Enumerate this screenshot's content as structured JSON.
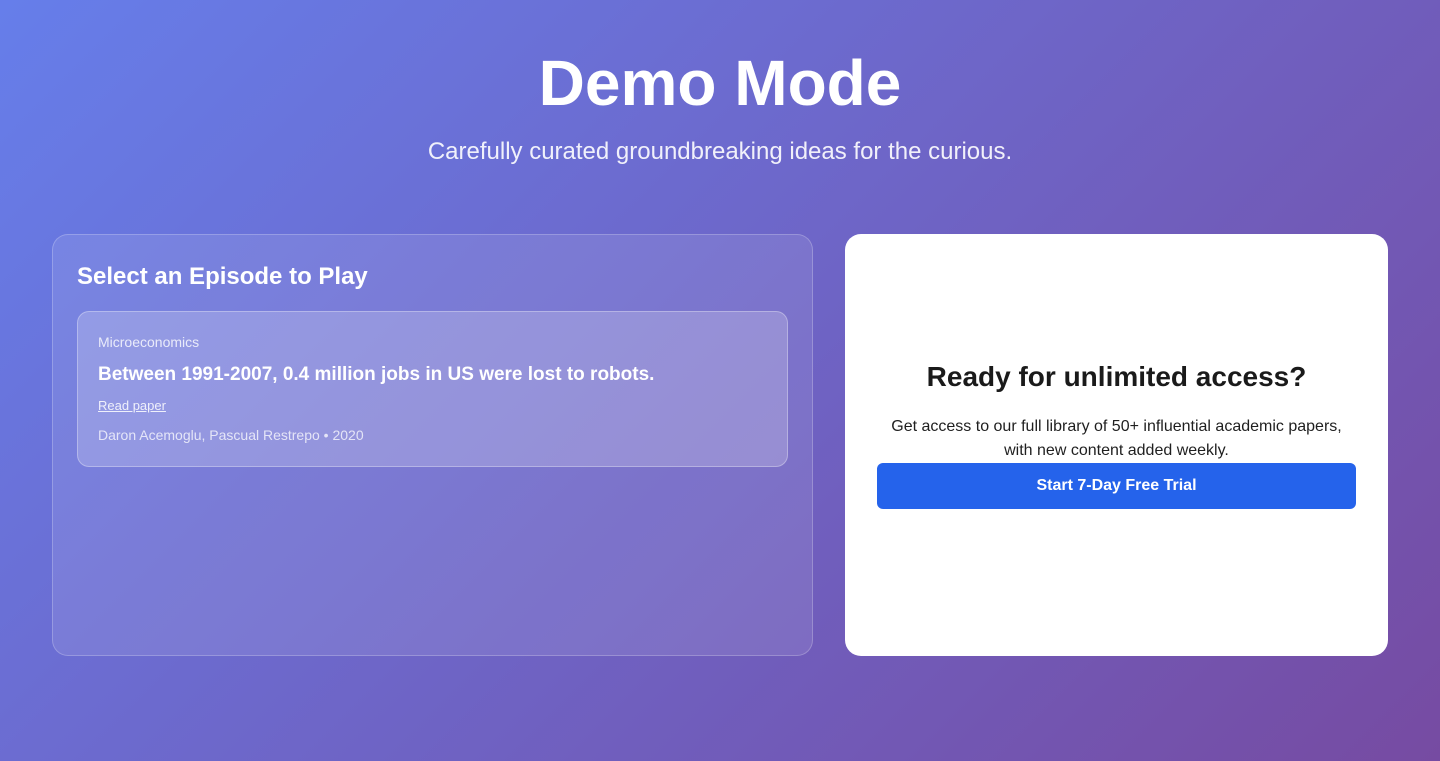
{
  "hero": {
    "title": "Demo Mode",
    "subtitle": "Carefully curated groundbreaking ideas for the curious."
  },
  "episodes": {
    "heading": "Select an Episode to Play",
    "items": [
      {
        "category": "Microeconomics",
        "title": "Between 1991-2007, 0.4 million jobs in US were lost to robots.",
        "link_label": "Read paper",
        "meta": "Daron Acemoglu, Pascual Restrepo • 2020"
      }
    ]
  },
  "cta": {
    "title": "Ready for unlimited access?",
    "body": "Get access to our full library of 50+ influential academic papers, with new content added weekly.",
    "button_label": "Start 7-Day Free Trial"
  },
  "colors": {
    "gradient_start": "#667eea",
    "gradient_end": "#764ba2",
    "primary_button": "#2563eb",
    "card_background": "#ffffff"
  }
}
